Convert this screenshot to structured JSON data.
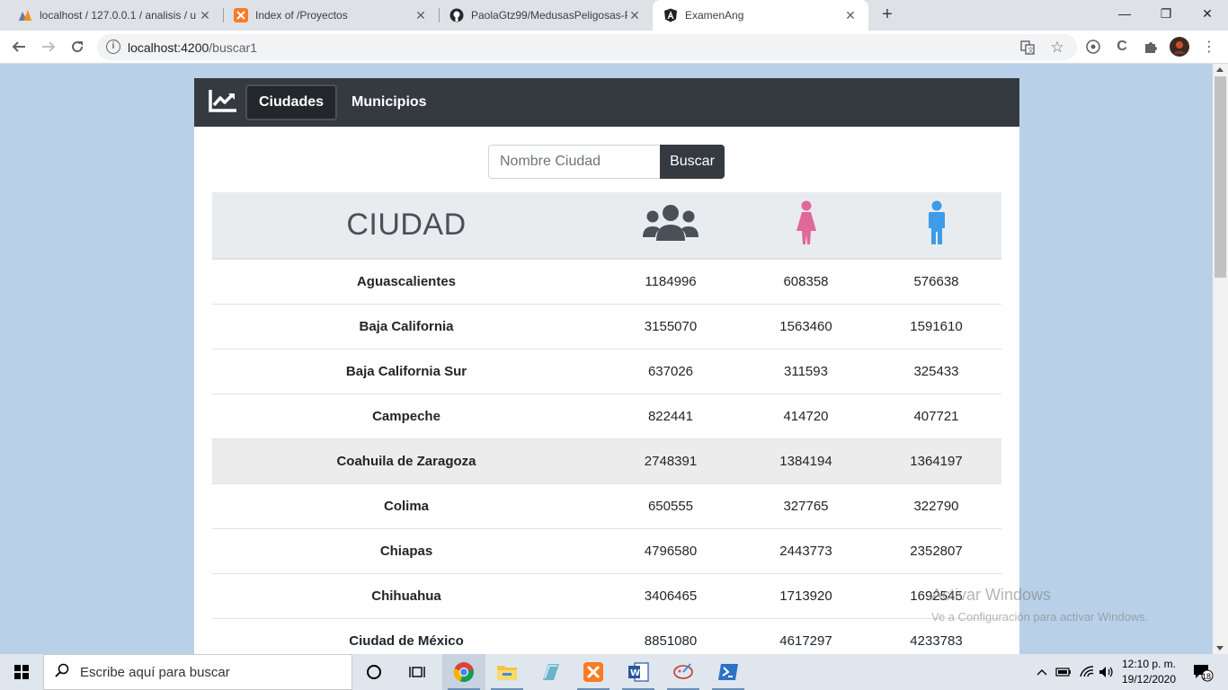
{
  "browser": {
    "tabs": [
      {
        "title": "localhost / 127.0.0.1 / analisis / u",
        "favicon": "phpmyadmin-icon"
      },
      {
        "title": "Index of /Proyectos",
        "favicon": "xampp-icon"
      },
      {
        "title": "PaolaGtz99/MedusasPeligosas-Pl",
        "favicon": "github-icon"
      },
      {
        "title": "ExamenAng",
        "favicon": "angular-icon"
      }
    ],
    "active_tab": 3,
    "url_host": "localhost:4200",
    "url_path": "/buscar1"
  },
  "app": {
    "nav": {
      "brand_icon": "chart-line-icon",
      "items": [
        {
          "label": "Ciudades"
        },
        {
          "label": "Municipios"
        }
      ],
      "active_index": 0
    },
    "search": {
      "placeholder": "Nombre Ciudad",
      "button_label": "Buscar"
    },
    "table": {
      "header_city": "CIUDAD",
      "header_icons": [
        "users-icon",
        "female-icon",
        "male-icon"
      ],
      "icon_colors": {
        "total": "#495057",
        "female": "#e0689a",
        "male": "#3d9be9"
      },
      "rows": [
        {
          "ciudad": "Aguascalientes",
          "total": "1184996",
          "mujeres": "608358",
          "hombres": "576638"
        },
        {
          "ciudad": "Baja California",
          "total": "3155070",
          "mujeres": "1563460",
          "hombres": "1591610"
        },
        {
          "ciudad": "Baja California Sur",
          "total": "637026",
          "mujeres": "311593",
          "hombres": "325433"
        },
        {
          "ciudad": "Campeche",
          "total": "822441",
          "mujeres": "414720",
          "hombres": "407721"
        },
        {
          "ciudad": "Coahuila de Zaragoza",
          "total": "2748391",
          "mujeres": "1384194",
          "hombres": "1364197"
        },
        {
          "ciudad": "Colima",
          "total": "650555",
          "mujeres": "327765",
          "hombres": "322790"
        },
        {
          "ciudad": "Chiapas",
          "total": "4796580",
          "mujeres": "2443773",
          "hombres": "2352807"
        },
        {
          "ciudad": "Chihuahua",
          "total": "3406465",
          "mujeres": "1713920",
          "hombres": "1692545"
        },
        {
          "ciudad": "Ciudad de México",
          "total": "8851080",
          "mujeres": "4617297",
          "hombres": "4233783"
        }
      ],
      "hovered_row": 4
    }
  },
  "watermark": {
    "title": "Activar Windows",
    "subtitle": "Ve a Configuración para activar Windows."
  },
  "taskbar": {
    "search_placeholder": "Escribe aquí para buscar",
    "time": "12:10 p. m.",
    "date": "19/12/2020",
    "notifications": "18"
  }
}
